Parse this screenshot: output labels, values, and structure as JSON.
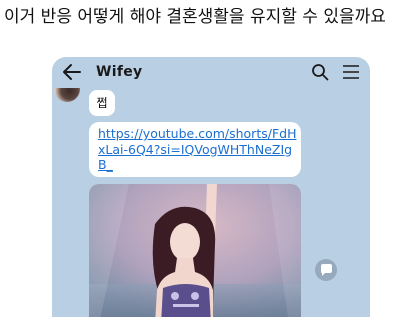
{
  "post": {
    "title": "이거 반응 어떻게 해야 결혼생활을 유지할 수 있을까요"
  },
  "chat": {
    "title": "Wifey",
    "icons": {
      "back": "arrow-left-icon",
      "search": "search-icon",
      "menu": "hamburger-menu-icon",
      "share": "share-icon"
    },
    "messages": [
      {
        "type": "text",
        "text": "쩝"
      },
      {
        "type": "link",
        "text": "https://youtube.com/shorts/FdHxLai-6Q4?si=IQVogWHThNeZIgB_"
      }
    ],
    "preview": {
      "description": "performer on stage with raised arm"
    }
  },
  "colors": {
    "chat_background": "#b9cfe4",
    "bubble": "#ffffff",
    "link": "#1b6fd1"
  }
}
